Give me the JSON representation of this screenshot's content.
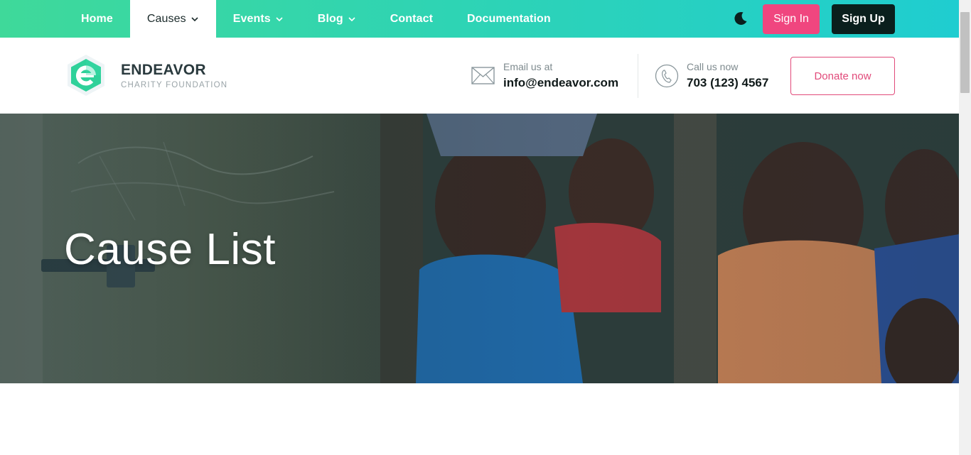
{
  "nav": {
    "items": [
      {
        "label": "Home",
        "dropdown": false,
        "active": false
      },
      {
        "label": "Causes",
        "dropdown": true,
        "active": true
      },
      {
        "label": "Events",
        "dropdown": true,
        "active": false
      },
      {
        "label": "Blog",
        "dropdown": true,
        "active": false
      },
      {
        "label": "Contact",
        "dropdown": false,
        "active": false
      },
      {
        "label": "Documentation",
        "dropdown": false,
        "active": false
      }
    ],
    "theme_icon": "moon-icon",
    "sign_in": "Sign In",
    "sign_up": "Sign Up"
  },
  "header": {
    "brand_name": "ENDEAVOR",
    "brand_tagline": "CHARITY FOUNDATION",
    "email_label": "Email us at",
    "email_value": "info@endeavor.com",
    "phone_label": "Call us now",
    "phone_value": "703 (123) 4567",
    "donate": "Donate now"
  },
  "hero": {
    "title": "Cause List"
  },
  "colors": {
    "nav_gradient_start": "#3fd99a",
    "nav_gradient_end": "#1fcdd0",
    "accent_pink": "#f0467f",
    "dark": "#0a1f1d",
    "logo_green": "#2fd19a"
  }
}
